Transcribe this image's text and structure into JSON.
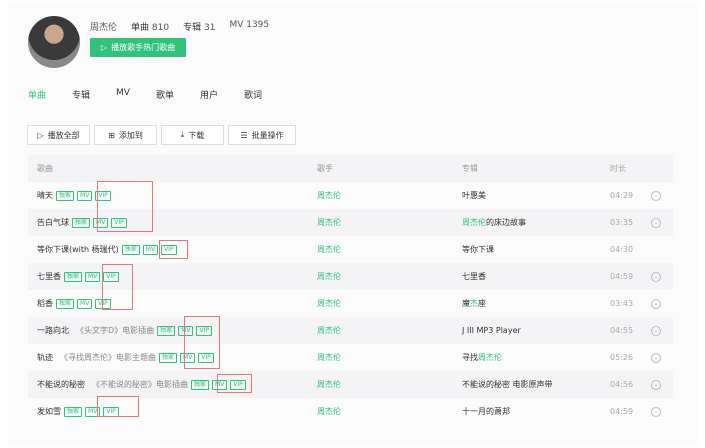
{
  "artist": {
    "name": "周杰伦",
    "singles_label": "单曲",
    "singles": "810",
    "albums_label": "专辑",
    "albums": "31",
    "mv_label": "MV",
    "mv": "1395",
    "play_hot": "播放歌手热门歌曲"
  },
  "tabs": [
    {
      "label": "单曲",
      "active": true
    },
    {
      "label": "专辑"
    },
    {
      "label": "MV"
    },
    {
      "label": "歌单"
    },
    {
      "label": "用户"
    },
    {
      "label": "歌词"
    }
  ],
  "toolbar": {
    "play_all": "播放全部",
    "add_to": "添加到",
    "download": "下载",
    "batch": "批量操作"
  },
  "table": {
    "headers": [
      "歌曲",
      "歌手",
      "专辑",
      "时长"
    ],
    "tags": {
      "exclusive": "独家",
      "mv": "MV",
      "vip": "VIP"
    },
    "rows": [
      {
        "song": "晴天",
        "sub": "",
        "singer": "周杰伦",
        "album": "叶惠美",
        "album_hl": "",
        "album_rest": "",
        "duration": "04:29",
        "more": true
      },
      {
        "song": "告白气球",
        "sub": "",
        "singer": "周杰伦",
        "album": "",
        "album_hl": "周杰伦",
        "album_rest": "的床边故事",
        "duration": "03:35",
        "more": true
      },
      {
        "song": "等你下课(with 杨瑞代)",
        "sub": "",
        "singer": "周杰伦",
        "album": "等你下课",
        "album_hl": "",
        "album_rest": "",
        "duration": "04:30",
        "more": false
      },
      {
        "song": "七里香",
        "sub": "",
        "singer": "周杰伦",
        "album": "七里香",
        "album_hl": "",
        "album_rest": "",
        "duration": "04:59",
        "more": true
      },
      {
        "song": "稻香",
        "sub": "",
        "singer": "周杰伦",
        "album": "魔",
        "album_hl": "杰",
        "album_rest": "座",
        "duration": "03:43",
        "more": true
      },
      {
        "song": "一路向北",
        "sub": "《头文字D》电影插曲",
        "singer": "周杰伦",
        "album": "J III MP3 Player",
        "album_hl": "",
        "album_rest": "",
        "duration": "04:55",
        "more": true
      },
      {
        "song": "轨迹",
        "sub": "《寻找周杰伦》电影主题曲",
        "singer": "周杰伦",
        "album": "寻找",
        "album_hl": "周杰伦",
        "album_rest": "",
        "duration": "05:26",
        "more": true
      },
      {
        "song": "不能说的秘密",
        "sub": "《不能说的秘密》电影插曲",
        "singer": "周杰伦",
        "album": "不能说的秘密 电影原声带",
        "album_hl": "",
        "album_rest": "",
        "duration": "04:56",
        "more": true
      },
      {
        "song": "发如雪",
        "sub": "",
        "singer": "周杰伦",
        "album": "十一月的萧邦",
        "album_hl": "",
        "album_rest": "",
        "duration": "04:59",
        "more": true
      }
    ]
  },
  "colors": {
    "accent": "#31c27c",
    "annotation": "#e07a7a"
  }
}
